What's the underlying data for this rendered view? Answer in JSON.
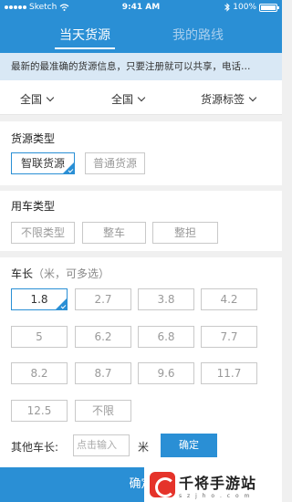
{
  "status": {
    "carrier": "Sketch",
    "time": "9:41 AM",
    "battery": "100%"
  },
  "tabs": [
    {
      "label": "当天货源"
    },
    {
      "label": "我的路线"
    }
  ],
  "notice": "最新的最准确的货源信息，只要注册就可以共享，电话…",
  "filters": [
    {
      "label": "全国"
    },
    {
      "label": "全国"
    },
    {
      "label": "货源标签"
    }
  ],
  "cargo_type": {
    "title": "货源类型",
    "options": [
      "智联货源",
      "普通货源"
    ],
    "selected": "智联货源"
  },
  "vehicle_type": {
    "title": "用车类型",
    "options": [
      "不限类型",
      "整车",
      "整担"
    ]
  },
  "length": {
    "title": "车长",
    "subtitle": "（米，可多选）",
    "options": [
      "1.8",
      "2.7",
      "3.8",
      "4.2",
      "5",
      "6.2",
      "6.8",
      "7.7",
      "8.2",
      "8.7",
      "9.6",
      "11.7",
      "12.5",
      "不限"
    ],
    "selected": "1.8",
    "other_label": "其他车长:",
    "other_placeholder": "点击输入",
    "unit": "米",
    "ok_label": "确定"
  },
  "confirm_label": "确定",
  "watermark": {
    "title": "千将手游站",
    "url": "s z j h o . c o m"
  },
  "colors": {
    "accent": "#2a8fd5",
    "notice_bg": "#d9e8f5"
  }
}
